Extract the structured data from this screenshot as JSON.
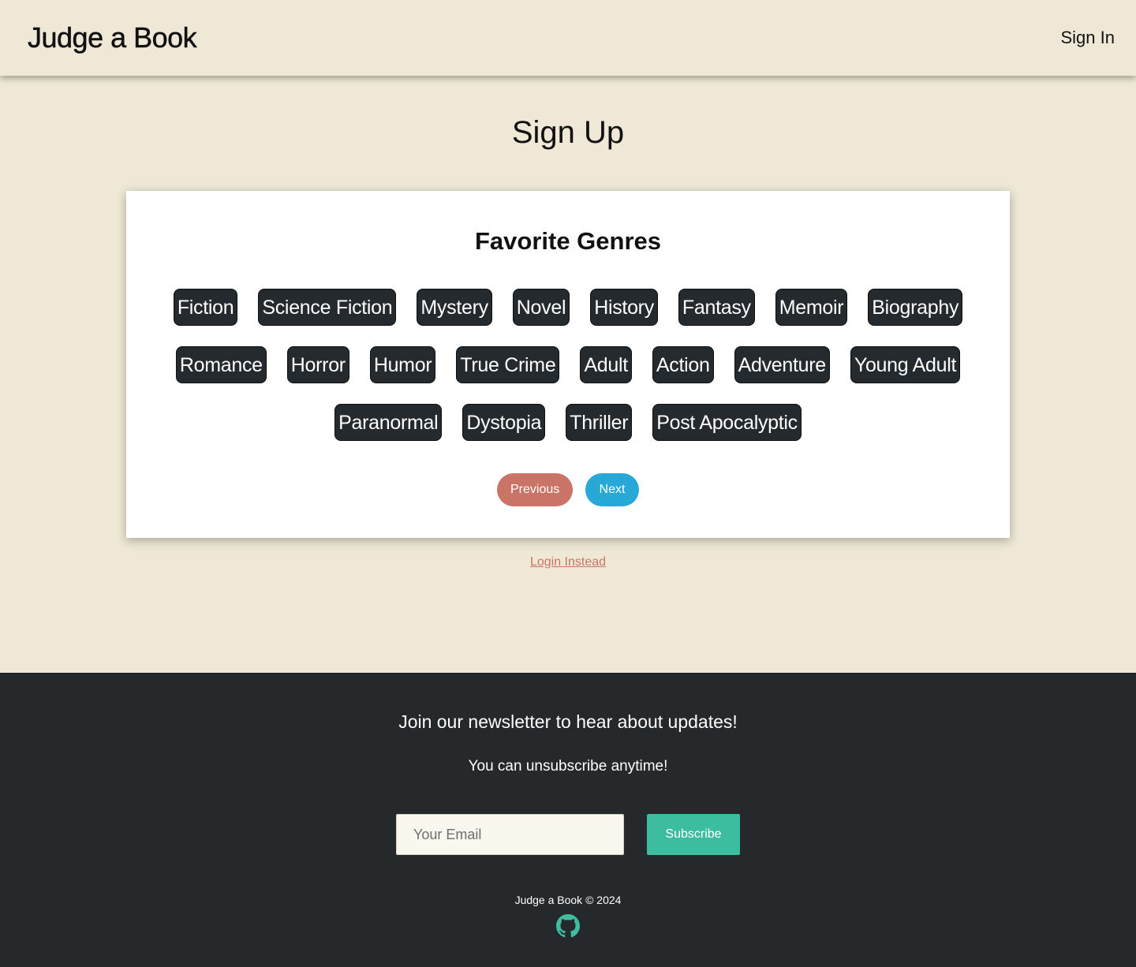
{
  "header": {
    "brand": "Judge a Book",
    "signin_label": "Sign In"
  },
  "page": {
    "title": "Sign Up"
  },
  "card": {
    "title": "Favorite Genres",
    "genres": [
      "Fiction",
      "Science Fiction",
      "Mystery",
      "Novel",
      "History",
      "Fantasy",
      "Memoir",
      "Biography",
      "Romance",
      "Horror",
      "Humor",
      "True Crime",
      "Adult",
      "Action",
      "Adventure",
      "Young Adult",
      "Paranormal",
      "Dystopia",
      "Thriller",
      "Post Apocalyptic"
    ],
    "previous_label": "Previous",
    "next_label": "Next"
  },
  "login_link": "Login Instead",
  "footer": {
    "newsletter_title": "Join our newsletter to hear about updates!",
    "newsletter_sub": "You can unsubscribe anytime!",
    "email_placeholder": "Your Email",
    "subscribe_label": "Subscribe",
    "copyright": "Judge a Book © 2024",
    "github_icon": "github-icon"
  },
  "colors": {
    "background": "#efe8d6",
    "footer_bg": "#25292c",
    "genre_bg": "#252a2e",
    "previous_btn": "#c97466",
    "next_btn": "#27a8d7",
    "subscribe_btn": "#3dbd9f",
    "login_link": "#c97466"
  }
}
